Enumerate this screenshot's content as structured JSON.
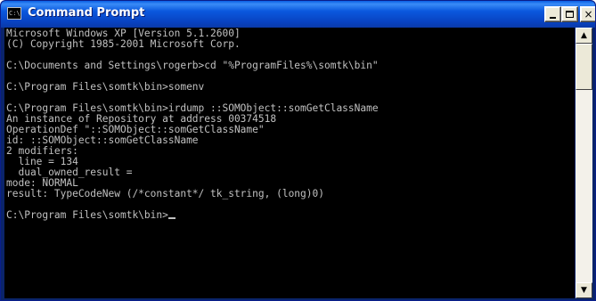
{
  "window": {
    "title": "Command Prompt",
    "icon": "cmd-icon",
    "controls": {
      "minimize": "minimize-icon",
      "maximize": "maximize-icon",
      "close": "×"
    }
  },
  "console": {
    "lines": [
      "Microsoft Windows XP [Version 5.1.2600]",
      "(C) Copyright 1985-2001 Microsoft Corp.",
      "",
      "C:\\Documents and Settings\\rogerb>cd \"%ProgramFiles%\\somtk\\bin\"",
      "",
      "C:\\Program Files\\somtk\\bin>somenv",
      "",
      "C:\\Program Files\\somtk\\bin>irdump ::SOMObject::somGetClassName",
      "An instance of Repository at address 00374518",
      "OperationDef \"::SOMObject::somGetClassName\"",
      "id: ::SOMObject::somGetClassName",
      "2 modifiers:",
      "  line = 134",
      "  dual_owned_result =",
      "mode: NORMAL",
      "result: TypeCodeNew (/*constant*/ tk_string, (long)0)",
      "",
      "C:\\Program Files\\somtk\\bin>"
    ]
  },
  "scrollbar": {
    "up": "▲",
    "down": "▼"
  },
  "colors": {
    "titlebar": "#0b58de",
    "console_bg": "#000000",
    "console_fg": "#c0c0c0"
  }
}
